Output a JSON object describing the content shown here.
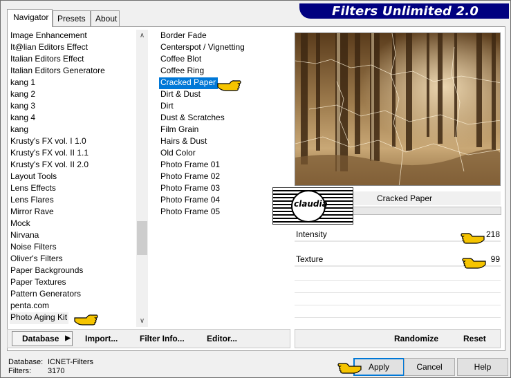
{
  "app": {
    "title": "Filters Unlimited 2.0",
    "tabs": [
      "Navigator",
      "Presets",
      "About"
    ]
  },
  "categories": [
    {
      "label": "Image Enhancement"
    },
    {
      "label": "It@lian Editors Effect"
    },
    {
      "label": "Italian Editors Effect"
    },
    {
      "label": "Italian Editors Generatore"
    },
    {
      "label": "kang 1"
    },
    {
      "label": "kang 2"
    },
    {
      "label": "kang 3"
    },
    {
      "label": "kang 4"
    },
    {
      "label": "kang"
    },
    {
      "label": "Krusty's FX vol. I 1.0"
    },
    {
      "label": "Krusty's FX vol. II 1.1"
    },
    {
      "label": "Krusty's FX vol. II 2.0"
    },
    {
      "label": "Layout Tools"
    },
    {
      "label": "Lens Effects"
    },
    {
      "label": "Lens Flares"
    },
    {
      "label": "Mirror Rave"
    },
    {
      "label": "Mock"
    },
    {
      "label": "Nirvana"
    },
    {
      "label": "Noise Filters"
    },
    {
      "label": "Oliver's Filters"
    },
    {
      "label": "Paper Backgrounds"
    },
    {
      "label": "Paper Textures"
    },
    {
      "label": "Pattern Generators"
    },
    {
      "label": "penta.com"
    },
    {
      "label": "Photo Aging Kit"
    }
  ],
  "selected_category_index": 24,
  "filters": [
    {
      "label": "Border Fade"
    },
    {
      "label": "Centerspot / Vignetting"
    },
    {
      "label": "Coffee Blot"
    },
    {
      "label": "Coffee Ring"
    },
    {
      "label": "Cracked Paper"
    },
    {
      "label": "Dirt & Dust"
    },
    {
      "label": "Dirt"
    },
    {
      "label": "Dust & Scratches"
    },
    {
      "label": "Film Grain"
    },
    {
      "label": "Hairs & Dust"
    },
    {
      "label": "Old Color"
    },
    {
      "label": "Photo Frame 01"
    },
    {
      "label": "Photo Frame 02"
    },
    {
      "label": "Photo Frame 03"
    },
    {
      "label": "Photo Frame 04"
    },
    {
      "label": "Photo Frame 05"
    }
  ],
  "selected_filter_index": 4,
  "preview": {
    "filter_title": "Cracked Paper",
    "parameters": [
      {
        "label": "Intensity",
        "value": "218"
      },
      {
        "label": "Texture",
        "value": "99"
      }
    ]
  },
  "toolbar": {
    "database": "Database",
    "import": "Import...",
    "filter_info": "Filter Info...",
    "editor": "Editor...",
    "randomize": "Randomize",
    "reset": "Reset"
  },
  "status": {
    "database_label": "Database:",
    "database_value": "ICNET-Filters",
    "filters_label": "Filters:",
    "filters_value": "3170"
  },
  "buttons": {
    "apply": "Apply",
    "cancel": "Cancel",
    "help": "Help"
  },
  "watermark": {
    "text": "claudia"
  },
  "colors": {
    "title_banner": "#000080",
    "selection": "#0078d7",
    "pointer_hand": "#f5c400"
  }
}
